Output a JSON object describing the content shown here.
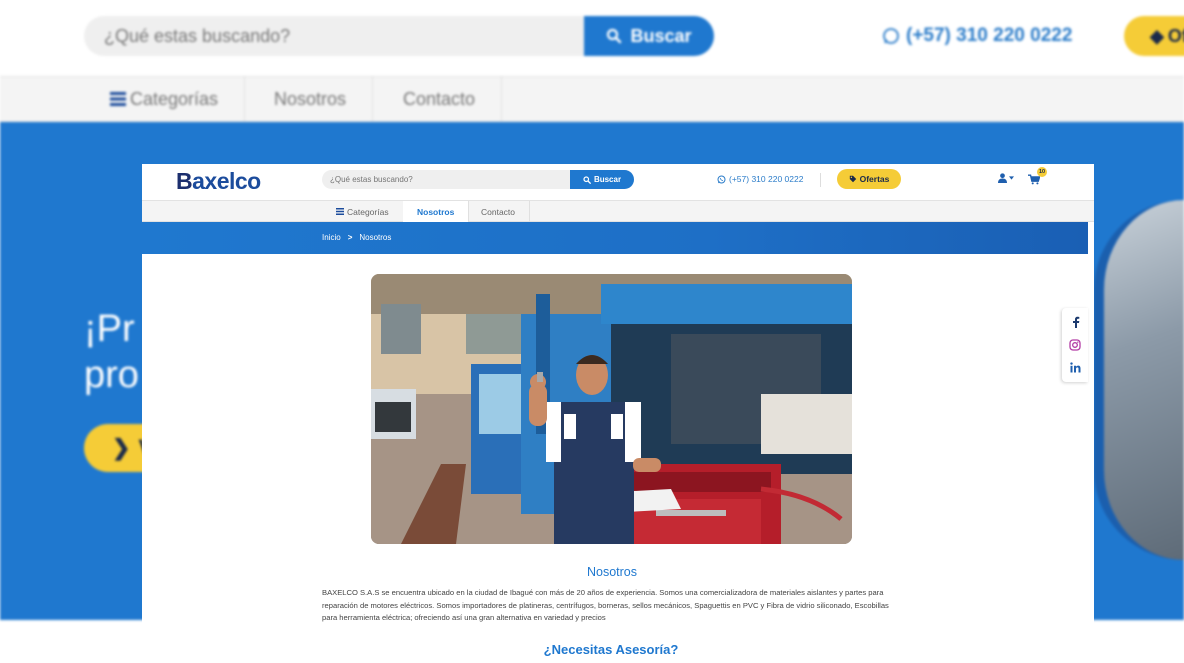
{
  "background": {
    "search": {
      "placeholder": "¿Qué estas buscando?",
      "button_label": "Buscar"
    },
    "phone": "(+57) 310 220 0222",
    "offer_label": "Of",
    "nav": [
      "Categorías",
      "Nosotros",
      "Contacto"
    ],
    "hero_lines": [
      "¡Pr",
      "pro"
    ],
    "hero_button_label": "V"
  },
  "header": {
    "logo_b": "B",
    "logo_rest": "axelco",
    "search": {
      "placeholder": "¿Qué estas buscando?",
      "button_label": "Buscar"
    },
    "phone": "(+57) 310 220 0222",
    "offers_label": "Ofertas",
    "cart_count": "10"
  },
  "nav": {
    "categories": "Categorías",
    "about": "Nosotros",
    "contact": "Contacto"
  },
  "breadcrumb": {
    "home": "Inicio",
    "separator": ">",
    "current": "Nosotros"
  },
  "about": {
    "title": "Nosotros",
    "body": "BAXELCO S.A.S se encuentra ubicado en la ciudad de Ibagué con más de 20 años de experiencia. Somos una comercializadora de materiales aislantes y partes para reparación de motores eléctricos. Somos importadores de platineras, centrífugos, borneras, sellos mecánicos, Spaguettis en PVC y Fibra de vidrio siliconado, Escobillas para herramienta eléctrica; ofreciendo así una gran alternativa en variedad y precios"
  },
  "help": {
    "title": "¿Necesitas Asesoría?"
  },
  "social": [
    "facebook-icon",
    "instagram-icon",
    "linkedin-icon"
  ],
  "colors": {
    "primary": "#1f78cf",
    "accent": "#f5cc37",
    "logo": "#1c4c9c",
    "whatsapp": "#2b7cc9"
  }
}
